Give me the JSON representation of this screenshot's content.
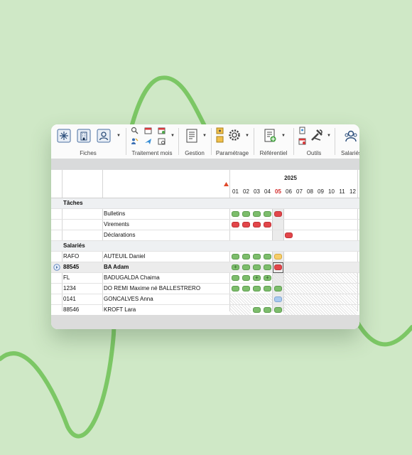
{
  "colors": {
    "background": "#cfe8c6",
    "curve": "#7cc765",
    "green_status": "#7dbd6c",
    "red_status": "#e2464a",
    "yellow_status": "#f6cd6a",
    "blue_status": "#a9c9ee",
    "current_month_marker": "#e0492a"
  },
  "ribbon": {
    "groups": [
      {
        "label": "Fiches",
        "icons": [
          "settings-snowflake-icon",
          "building-icon",
          "employee-card-icon"
        ]
      },
      {
        "label": "Traitement mois",
        "icons": [
          "search-calc-icon",
          "calendar-icon",
          "calendar-edit-icon",
          "people-icon",
          "plane-icon",
          "calendar-view-icon"
        ]
      },
      {
        "label": "Gestion",
        "icons": [
          "document-list-icon"
        ]
      },
      {
        "label": "Paramétrage",
        "icons": [
          "cards-icon",
          "gear-icon"
        ]
      },
      {
        "label": "Référentiel",
        "icons": [
          "book-add-icon"
        ]
      },
      {
        "label": "Outils",
        "icons": [
          "device-icon",
          "calendar-alert-icon",
          "tools-icon"
        ]
      },
      {
        "label": "Salariés",
        "icons": [
          "users-icon"
        ]
      }
    ]
  },
  "grid": {
    "year": "2025",
    "months": [
      "01",
      "02",
      "03",
      "04",
      "05",
      "06",
      "07",
      "08",
      "09",
      "10",
      "11",
      "12"
    ],
    "current_month": "05",
    "sections": {
      "tasks": "Tâches",
      "employees": "Salariés"
    },
    "tasks": [
      {
        "name": "Bulletins",
        "statuses": [
          "green",
          "green",
          "green",
          "green",
          "red"
        ]
      },
      {
        "name": "Virements",
        "statuses": [
          "red",
          "red",
          "red",
          "red",
          "none"
        ]
      },
      {
        "name": "Déclarations",
        "statuses": [
          "none",
          "none",
          "none",
          "none",
          "none",
          "red"
        ]
      }
    ],
    "employees": [
      {
        "code": "RAFO",
        "name": "AUTEUIL Daniel"
      },
      {
        "code": "88545",
        "name": "BA Adam"
      },
      {
        "code": "FL",
        "name": "BADUGALDA Chaima"
      },
      {
        "code": "1234",
        "name": "DO REMI Maxime né BALLESTRERO"
      },
      {
        "code": "0141",
        "name": "GONCALVES Anna"
      },
      {
        "code": "88546",
        "name": "KROFT Lara"
      }
    ],
    "plus_mark": "+"
  }
}
